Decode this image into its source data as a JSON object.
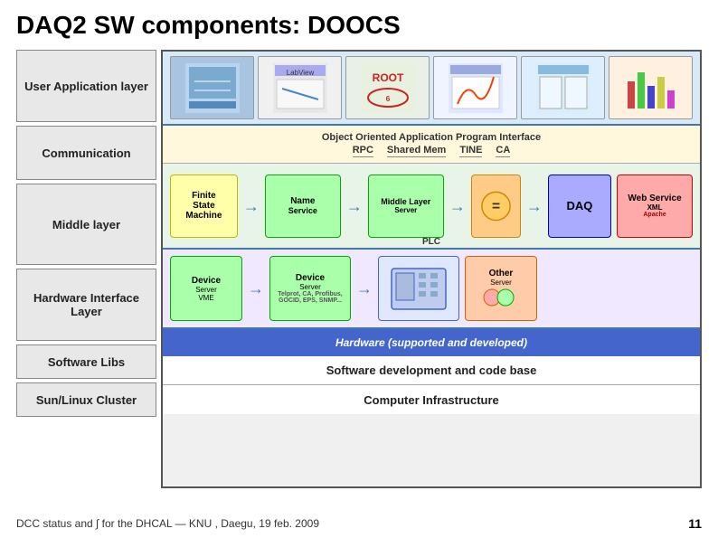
{
  "page": {
    "title": "DAQ2 SW components: DOOCS"
  },
  "left_labels": {
    "user_app": "User Application layer",
    "communication": "Communication",
    "middle": "Middle layer",
    "hardware": "Hardware Interface Layer",
    "software_libs": "Software Libs",
    "sun_linux": "Sun/Linux Cluster"
  },
  "diagram": {
    "ooapi_title": "Object Oriented Application Program Interface",
    "rpc": "RPC",
    "shared_mem": "Shared Mem",
    "tine": "TINE",
    "ca": "CA",
    "fsm_box": {
      "line1": "Finite",
      "line2": "State",
      "line3": "Machine"
    },
    "name_service": {
      "title": "Name",
      "sub": "Service"
    },
    "mls_box": {
      "title": "Middle Layer",
      "sub": "Server"
    },
    "daq_box": "DAQ",
    "web_service": {
      "title": "Web Service",
      "sub": "XML"
    },
    "device_vme": {
      "title": "Device",
      "sub": "Server",
      "sub2": "VME"
    },
    "device_tango": {
      "title": "Device",
      "sub": "Server",
      "sub2": "Telprot, CA, Profibus, GOCID, EPS, SNMP..."
    },
    "plc_label": "PLC",
    "other_server": {
      "title": "Other",
      "sub": "Server"
    },
    "hw_supported": "Hardware (supported and developed)",
    "sw_dev": "Software development and code base",
    "computer_infra": "Computer Infrastructure"
  },
  "footer": {
    "text": "DCC status and ∫ for the DHCAL — KNU , Daegu, 19 feb. 2009",
    "page_num": "11"
  }
}
